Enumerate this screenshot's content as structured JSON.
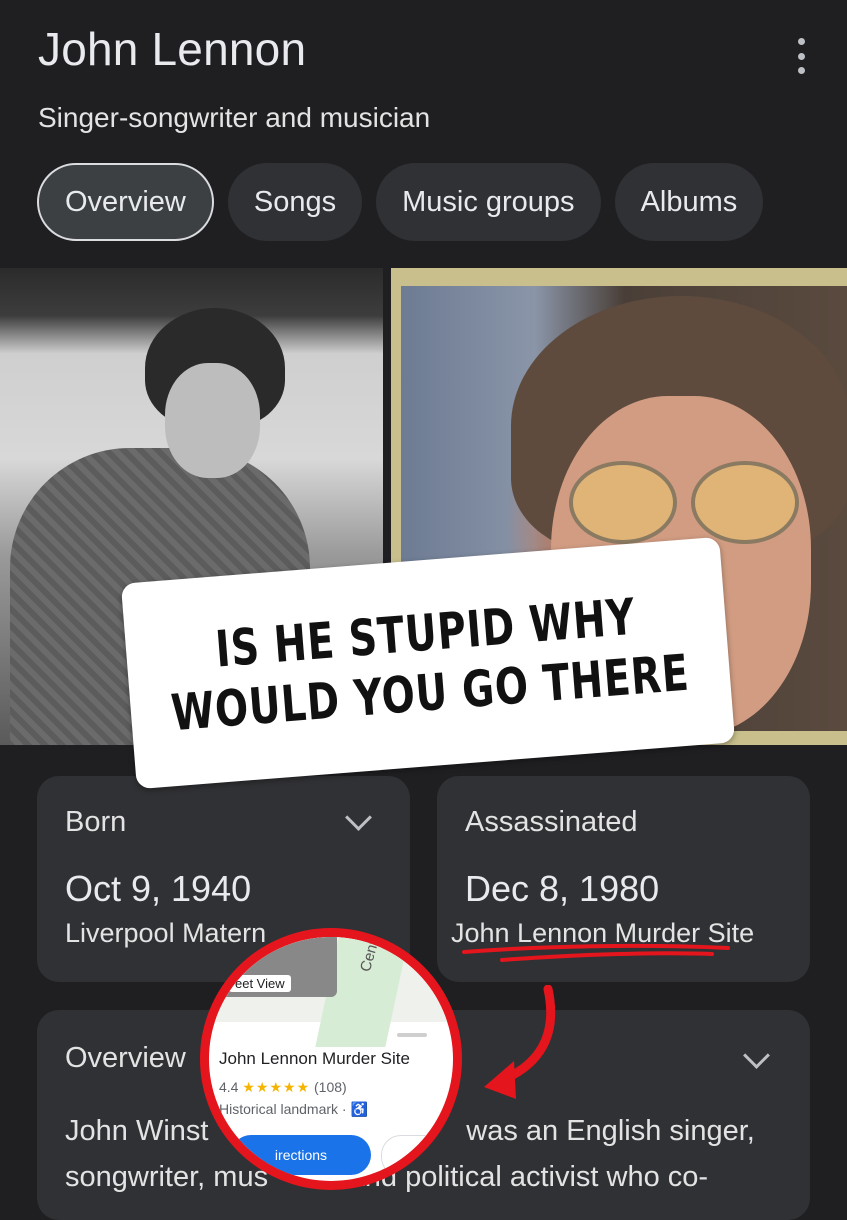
{
  "header": {
    "title": "John Lennon",
    "subtitle": "Singer-songwriter and musician",
    "menu_icon": "more-vert-icon"
  },
  "tabs": [
    {
      "label": "Overview",
      "active": true
    },
    {
      "label": "Songs",
      "active": false
    },
    {
      "label": "Music groups",
      "active": false
    },
    {
      "label": "Albums",
      "active": false
    }
  ],
  "overlay_caption": {
    "line1": "IS HE STUPID WHY",
    "line2": "WOULD YOU GO THERE"
  },
  "born_card": {
    "label": "Born",
    "date": "Oct 9, 1940",
    "place": "Liverpool Matern"
  },
  "assassinated_card": {
    "label": "Assassinated",
    "date": "Dec 8, 1980",
    "place": "John Lennon Murder Site"
  },
  "overview_card": {
    "title": "Overview",
    "text_line1": "John Winst                                was an English singer,",
    "text_line2": "songwriter, mus          and political activist who co-"
  },
  "map_popup": {
    "street_view_label": "eet View",
    "road_label": "Central",
    "place_title": "John Lennon Murder Site",
    "rating": "4.4",
    "stars": "★★★★★",
    "review_count": "(108)",
    "place_type": "Historical landmark ·",
    "accessibility_icon": "♿",
    "directions_label": "irections"
  },
  "colors": {
    "background": "#1f1f22",
    "card": "#303134",
    "annotation_red": "#e4151c",
    "link_blue": "#1a73e8"
  }
}
